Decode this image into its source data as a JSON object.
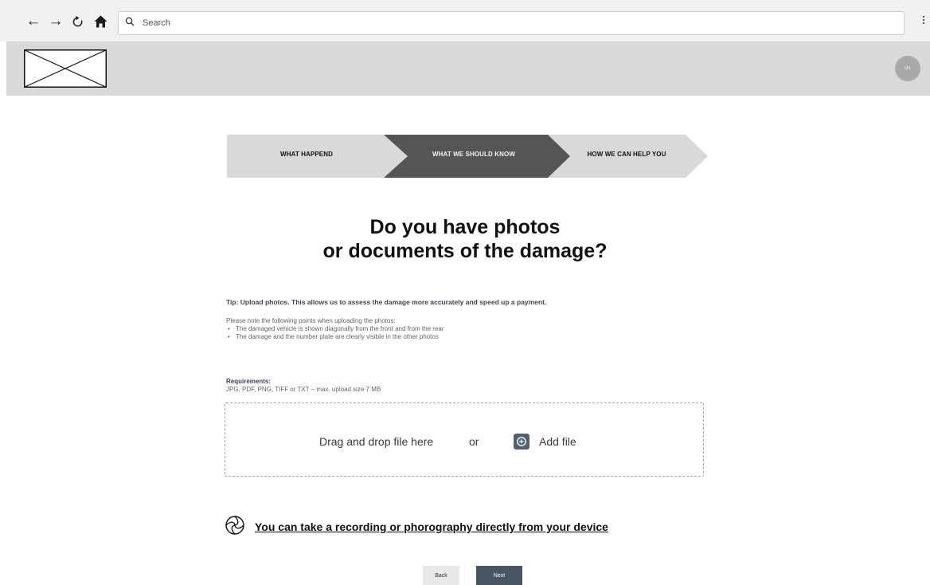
{
  "browser": {
    "back_glyph": "←",
    "forward_glyph": "→",
    "reload_glyph": "⟳",
    "search_placeholder": "Search",
    "icons": [
      "back-arrow-icon",
      "forward-arrow-icon",
      "reload-icon",
      "home-icon",
      "search-icon",
      "kebab-menu-icon"
    ]
  },
  "header": {
    "avatar_initials": "MA"
  },
  "stepper": {
    "steps": [
      {
        "label": "WHAT HAPPEND",
        "state": "inactive"
      },
      {
        "label": "WHAT WE SHOULD KNOW",
        "state": "active"
      },
      {
        "label": "HOW WE CAN HELP YOU",
        "state": "inactive"
      }
    ],
    "colors": {
      "inactive": "#d9d9d9",
      "active": "#555555",
      "inactive_text": "#111111",
      "active_text": "#f2f2f2"
    }
  },
  "main": {
    "heading_line1": "Do you have photos",
    "heading_line2": "or documents of the damage?",
    "tip": "Tip: Upload photos. This allows us to assess the damage more accurately and speed up a payment.",
    "note": "Please note the following points when uploading the photos:",
    "bullets": [
      "The damaged vehicle is shown diagonally from the front and from the rear",
      "The damage and the number plate are clearly visible in the other photos"
    ],
    "requirements_title": "Requirements:",
    "requirements_text": "JPG, PDF, PNG, TIFF or TXT – max. upload size 7 MB",
    "dropzone": {
      "drag_text": "Drag and drop file here",
      "or_text": "or",
      "add_file_label": "Add file"
    },
    "record_link": "You can take a recording or phorography directly from your device"
  },
  "actions": {
    "back_label": "Back",
    "next_label": "Next"
  },
  "colors": {
    "header_bg": "#d9d9d9",
    "button_primary": "#4a5564",
    "button_secondary": "#e8e8e8"
  }
}
